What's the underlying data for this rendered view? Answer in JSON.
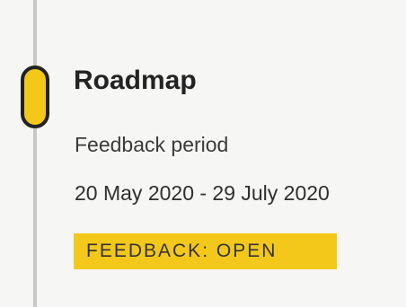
{
  "timeline": {
    "entry": {
      "title": "Roadmap",
      "subtitle": "Feedback period",
      "dates": "20 May 2020 - 29 July 2020",
      "status_badge": "FEEDBACK: OPEN"
    }
  },
  "colors": {
    "accent": "#f3c81a",
    "marker_border": "#222222",
    "line": "#c8c8c8",
    "background": "#f6f6f5"
  }
}
